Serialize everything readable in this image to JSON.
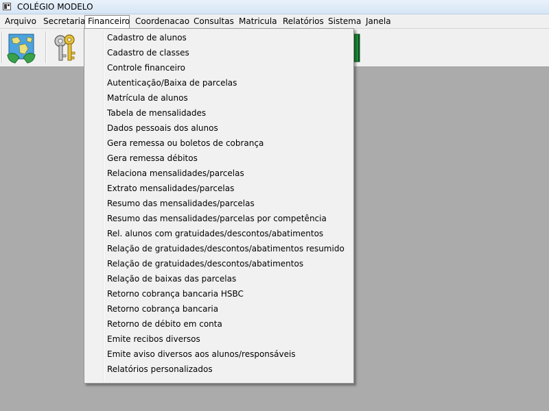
{
  "window": {
    "title": "COLÉGIO MODELO"
  },
  "menubar": {
    "items": [
      {
        "label": "Arquivo"
      },
      {
        "label": "Secretaria"
      },
      {
        "label": "Financeiro",
        "active": true
      },
      {
        "label": "Coordenacao"
      },
      {
        "label": "Consultas"
      },
      {
        "label": "Matricula"
      },
      {
        "label": "Relatórios"
      },
      {
        "label": "Sistema"
      },
      {
        "label": "Janela"
      }
    ]
  },
  "toolbar": {
    "buttons": [
      {
        "icon": "world-map-icon"
      },
      {
        "icon": "keys-icon"
      },
      {
        "icon": "green-book-icon"
      }
    ]
  },
  "dropdown": {
    "items": [
      {
        "label": "Cadastro de alunos"
      },
      {
        "label": "Cadastro de classes"
      },
      {
        "label": "Controle financeiro"
      },
      {
        "label": "Autenticação/Baixa de parcelas"
      },
      {
        "label": "Matrícula de alunos"
      },
      {
        "label": "Tabela de mensalidades"
      },
      {
        "label": "Dados pessoais dos alunos"
      },
      {
        "label": "Gera remessa ou boletos de cobrança"
      },
      {
        "label": "Gera remessa débitos"
      },
      {
        "label": "Relaciona mensalidades/parcelas"
      },
      {
        "label": "Extrato mensalidades/parcelas"
      },
      {
        "label": "Resumo das mensalidades/parcelas"
      },
      {
        "label": "Resumo das mensalidades/parcelas por competência"
      },
      {
        "label": "Rel. alunos com gratuidades/descontos/abatimentos"
      },
      {
        "label": "Relação de gratuidades/descontos/abatimentos resumido"
      },
      {
        "label": "Relação de gratuidades/descontos/abatimentos"
      },
      {
        "label": "Relação de baixas das parcelas"
      },
      {
        "label": "Retorno cobrança bancaria HSBC"
      },
      {
        "label": "Retorno cobrança bancaria"
      },
      {
        "label": "Retorno de débito em conta"
      },
      {
        "label": "Emite recibos diversos"
      },
      {
        "label": "Emite aviso diversos aos alunos/responsáveis"
      },
      {
        "label": "Relatórios personalizados"
      }
    ]
  }
}
